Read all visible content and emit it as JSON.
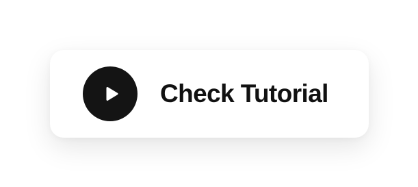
{
  "tutorial_button": {
    "label": "Check Tutorial",
    "icon": "play-icon"
  },
  "colors": {
    "background": "#ffffff",
    "button_background": "#ffffff",
    "icon_circle": "#141414",
    "icon_glyph": "#ffffff",
    "label_text": "#111111"
  }
}
